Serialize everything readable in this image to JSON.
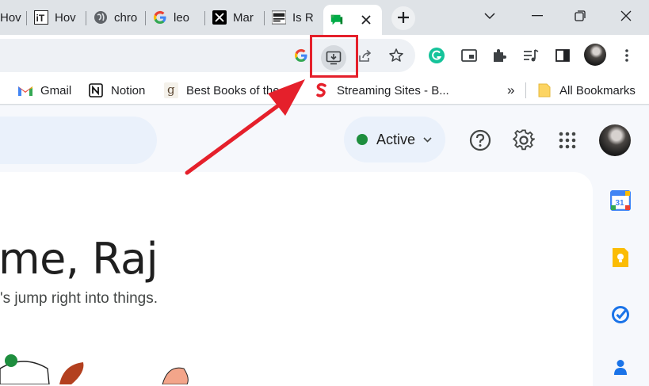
{
  "tabs": [
    {
      "label": "Hov",
      "icon": "hashtag-icon"
    },
    {
      "label": "Hov",
      "icon": "it-logo-icon"
    },
    {
      "label": "chro",
      "icon": "globe-icon"
    },
    {
      "label": "leo",
      "icon": "google-g-icon"
    },
    {
      "label": "Mar",
      "icon": "x-logo-icon"
    },
    {
      "label": "Is R",
      "icon": "film-companion-icon"
    },
    {
      "label": "",
      "icon": "google-chat-icon"
    }
  ],
  "toolbar_icons": [
    "google-g-icon",
    "install-app-icon",
    "share-icon",
    "bookmark-star-icon",
    "grammarly-icon",
    "picture-in-picture-icon",
    "extensions-icon",
    "media-controls-icon",
    "side-panel-icon",
    "profile-avatar",
    "more-menu-icon"
  ],
  "bookmarks": {
    "items": [
      {
        "label": "Gmail",
        "icon": "gmail-icon"
      },
      {
        "label": "Notion",
        "icon": "notion-icon"
      },
      {
        "label": "Best Books of the 2",
        "icon": "goodreads-icon"
      },
      {
        "label": "Streaming Sites - B...",
        "icon": "streaming-s-icon"
      }
    ],
    "overflow": "»",
    "all_bookmarks": "All Bookmarks"
  },
  "page": {
    "status": "Active",
    "greeting": "me, Raj",
    "subline": "'s jump right into things."
  },
  "colors": {
    "accent_red": "#e5202b",
    "status_green": "#1e8e3e",
    "tab_strip": "#dfe3e7",
    "page_bg": "#f6f8fc"
  }
}
